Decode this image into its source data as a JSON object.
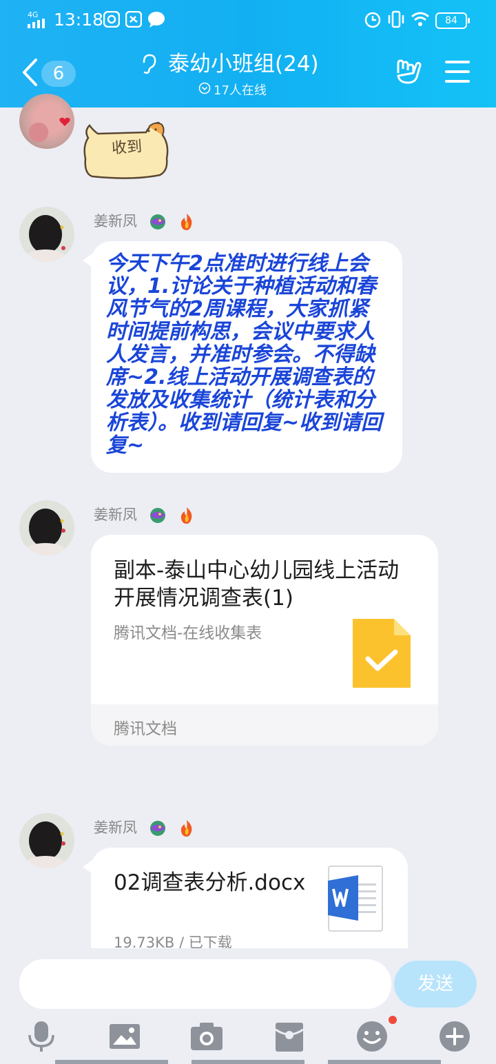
{
  "status_bar": {
    "network": "4G",
    "time": "13:18",
    "battery": "84"
  },
  "header": {
    "back_badge": "6",
    "title": "泰幼小班组(24)",
    "online": "17人在线"
  },
  "messages": [
    {
      "sender": "",
      "type": "sticker",
      "sticker_text": "收到"
    },
    {
      "sender": "姜新凤",
      "type": "text",
      "text": "今天下午2点准时进行线上会议，1.讨论关于种植活动和春风节气的2周课程，大家抓紧时间提前构思，会议中要求人人发言，并准时参会。不得缺席~2.线上活动开展调查表的发放及收集统计（统计表和分析表）。收到请回复~收到请回复~",
      "text_color": "#1a45d8"
    },
    {
      "sender": "姜新凤",
      "type": "card",
      "card_title": "副本-泰山中心幼儿园线上活动开展情况调查表(1)",
      "card_sub": "腾讯文档-在线收集表",
      "card_footer": "腾讯文档",
      "icon": "check-document-icon"
    },
    {
      "sender": "姜新凤",
      "type": "file",
      "file_name": "02调查表分析.docx",
      "file_status": "19.73KB / 已下载",
      "icon": "word-file-icon"
    }
  ],
  "input": {
    "placeholder": "",
    "send_label": "发送"
  },
  "toolbar": [
    "microphone-icon",
    "image-icon",
    "camera-icon",
    "red-packet-icon",
    "emoji-icon",
    "plus-icon"
  ],
  "colors": {
    "header": "#12b0f2",
    "accent_blue_text": "#1a45d8",
    "send_disabled": "#b8e4fb",
    "doc_yellow": "#fcc22e",
    "word_blue": "#2f6fd6"
  }
}
